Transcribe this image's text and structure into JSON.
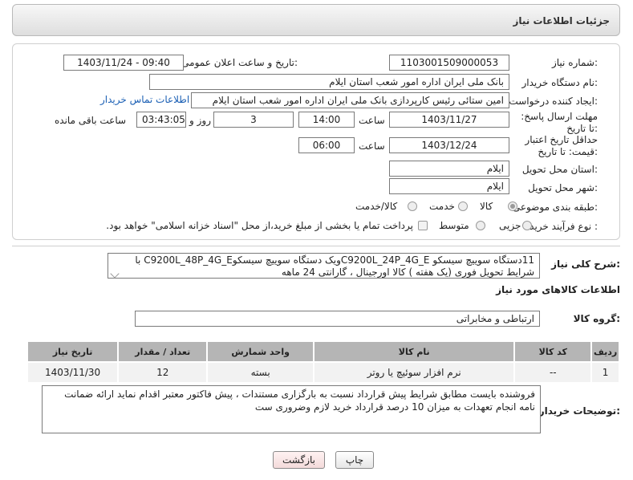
{
  "page": {
    "title": "جزئیات اطلاعات نیاز"
  },
  "form": {
    "need_number_label": "شماره نیاز:",
    "need_number": "1103001509000053",
    "announce_label": "تاریخ و ساعت اعلان عمومی:",
    "announce_value": "1403/11/24 - 09:40",
    "buyer_org_label": "نام دستگاه خریدار:",
    "buyer_org": "بانک ملی ایران اداره امور شعب استان ایلام",
    "creator_label": "ایجاد کننده درخواست:",
    "creator": "امین ستائی رئیس کارپردازی بانک ملی ایران اداره امور شعب استان ایلام",
    "contact_link": "اطلاعات تماس خریدار",
    "deadline_label": "مهلت ارسال پاسخ: تا تاریخ:",
    "deadline_date": "1403/11/27",
    "time_label": "ساعت",
    "deadline_time": "14:00",
    "days_value": "3",
    "days_label": "روز و",
    "remaining_value": "03:43:05",
    "remaining_label": "ساعت باقی مانده",
    "validity_label": "حداقل تاریخ اعتبار قیمت: تا تاریخ:",
    "validity_date": "1403/12/24",
    "validity_time": "06:00",
    "province_label": "استان محل تحویل:",
    "province": "ایلام",
    "city_label": "شهر محل تحویل:",
    "city": "ایلام",
    "category_label": "طبقه بندی موضوعی:",
    "category_options": [
      "کالا",
      "خدمت",
      "کالا/خدمت"
    ],
    "process_label": "نوع فرآیند خرید :",
    "process_options": [
      "جزیی",
      "متوسط"
    ],
    "payment_note": "پرداخت تمام یا بخشی از مبلغ خرید،از محل \"اسناد خزانه اسلامی\" خواهد بود."
  },
  "description": {
    "label": "شرح کلی نیاز:",
    "text": "11دستگاه سوییچ سیسکو C9200L_24P_4G_Eویک دستگاه سوییچ سیسکوC9200L_48P_4G_E با شرایط تحویل فوری (یک هفته ) کالا اورجینال ، گارانتی 24 ماهه"
  },
  "goods": {
    "section_title": "اطلاعات کالاهای مورد نیاز",
    "group_label": "گروه کالا:",
    "group_value": "ارتباطی و مخابراتی",
    "columns": [
      "ردیف",
      "کد کالا",
      "نام کالا",
      "واحد شمارش",
      "تعداد / مقدار",
      "تاریخ نیاز"
    ],
    "rows": [
      [
        "1",
        "--",
        "نرم افزار سوئیچ یا روتر",
        "بسته",
        "12",
        "1403/11/30"
      ]
    ]
  },
  "notes": {
    "label": "توضیحات خریدار:",
    "text": "فروشنده بایست مطابق شرایط پیش قرارداد نسبت به بارگزاری مستندات ، پیش فاکتور معتبر اقدام نماید ارائه ضمانت نامه انجام تعهدات به میزان 10 درصد قرارداد  خرید لازم وضروری ست"
  },
  "buttons": {
    "print": "چاپ",
    "back": "بازگشت"
  }
}
